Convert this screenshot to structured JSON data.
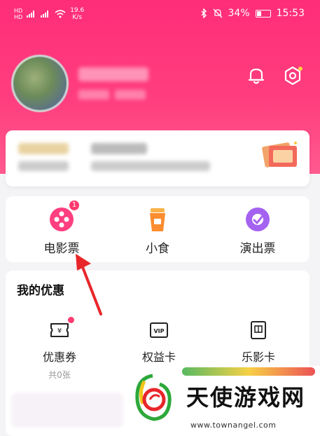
{
  "status_bar": {
    "network_speed": "19.6",
    "network_unit": "K/s",
    "battery": "34%",
    "time": "15:53"
  },
  "quick_actions": [
    {
      "label": "电影票",
      "badge": "1",
      "icon": "film-reel-icon"
    },
    {
      "label": "小食",
      "icon": "drink-cup-icon"
    },
    {
      "label": "演出票",
      "icon": "music-disc-icon"
    }
  ],
  "discounts": {
    "title": "我的优惠",
    "items": [
      {
        "label": "优惠券",
        "sub": "共0张",
        "icon": "coupon-icon",
        "has_dot": true
      },
      {
        "label": "权益卡",
        "sub": "",
        "icon": "vip-card-icon"
      },
      {
        "label": "乐影卡",
        "sub": "",
        "icon": "film-card-icon"
      }
    ]
  },
  "watermark": {
    "text": "天使游戏网",
    "url": "www.townangel.com"
  },
  "colors": {
    "brand_pink": "#ff2d78",
    "badge_red": "#ff3a6e",
    "arrow_red": "#e8262a"
  }
}
